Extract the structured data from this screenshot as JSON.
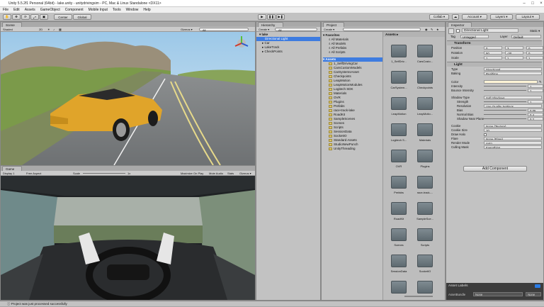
{
  "titlebar": {
    "text": "Unity 5.5.2f1 Personal (64bit) - lake.unity - unitydrivingsim - PC, Mac & Linux Standalone <DX11>"
  },
  "menu": [
    "File",
    "Edit",
    "Assets",
    "GameObject",
    "Component",
    "Mobile Input",
    "Tools",
    "Window",
    "Help"
  ],
  "toolbar": {
    "center": "Center",
    "global": "Global",
    "collab": "Collab ▾",
    "account": "Account ▾",
    "layers": "Layers ▾",
    "layout": "Layout ▾"
  },
  "scene": {
    "tab": "Scene",
    "shaded": "Shaded",
    "mode2d": "2D",
    "gizmos": "Gizmos ▾",
    "search": "All"
  },
  "game": {
    "tab": "Game",
    "display": "Display 1",
    "aspect": "Free Aspect",
    "scale_label": "Scale",
    "scale_value": "1x",
    "maximize": "Maximize On Play",
    "mute": "Mute Audio",
    "stats": "Stats",
    "gizmos": "Gizmos ▾"
  },
  "hierarchy": {
    "tab": "Hierarchy",
    "create": "Create ▾",
    "search": "All",
    "scene_name": "lake",
    "items": [
      "Directional Light",
      "Car",
      "LakeTrack",
      "CheckPoints"
    ]
  },
  "project": {
    "tab": "Project",
    "create": "Create ▾",
    "favorites_label": "Favorites",
    "favorites": [
      "All Materials",
      "All Models",
      "All Prefabs",
      "All Scripts"
    ],
    "assets_label": "Assets",
    "folders": [
      "1_SelfDrivingCar",
      "CarsCustomModels",
      "CarSystemsAsset",
      "Checkpoints",
      "LeapMotion",
      "LeapMotionModules",
      "Logitech SDK",
      "Materials",
      "OVR",
      "Plugins",
      "Prefabs",
      "race-track-lake",
      "RoadKit",
      "SampleScenes",
      "Scenes",
      "Scripts",
      "SessionData",
      "SocketIO",
      "Standard Assets",
      "StudioNewPunch",
      "UnityThreading"
    ],
    "grid_header": "Assets ▸",
    "grid": [
      "1_SelfDriv...",
      "CarsCusto...",
      "CarSystem...",
      "Checkpoints",
      "LeapMotion",
      "LeapMotio...",
      "Logitech S...",
      "Materials",
      "OVR",
      "Plugins",
      "Prefabs",
      "race-track-...",
      "RoadKit",
      "SampleSce...",
      "Scenes",
      "Scripts",
      "SessionData",
      "SocketIO",
      "",
      ""
    ]
  },
  "inspector": {
    "tab": "Inspector",
    "object_name": "Directional Light",
    "static": "Static ▾",
    "tag_label": "Tag",
    "tag_value": "Untagged",
    "layer_label": "Layer",
    "layer_value": "Default",
    "transform": {
      "header": "Transform",
      "position": [
        "0",
        "3",
        "0"
      ],
      "rotation": [
        "50",
        "-30",
        "0"
      ],
      "scale": [
        "1",
        "1",
        "1"
      ],
      "pos_label": "Position",
      "rot_label": "Rotation",
      "scale_label": "Scale"
    },
    "light_header": "Light",
    "light_rows": [
      {
        "k": "Type",
        "v": "Directional"
      },
      {
        "k": "Baking",
        "v": "Realtime"
      },
      {
        "k": "Color",
        "v": ""
      },
      {
        "k": "Intensity",
        "v": "1"
      },
      {
        "k": "Bounce Intensity",
        "v": "1"
      },
      {
        "k": "Shadow Type",
        "v": "Soft Shadows"
      },
      {
        "k": "Strength",
        "v": "1"
      },
      {
        "k": "Resolution",
        "v": "Use Quality Settings"
      },
      {
        "k": "Bias",
        "v": "0.05"
      },
      {
        "k": "Normal Bias",
        "v": "0.4"
      },
      {
        "k": "Shadow Near Plane",
        "v": "0.2"
      },
      {
        "k": "Cookie",
        "v": "None (Texture)"
      },
      {
        "k": "Cookie Size",
        "v": "10"
      },
      {
        "k": "Draw Halo",
        "v": ""
      },
      {
        "k": "Flare",
        "v": "None (Flare)"
      },
      {
        "k": "Render Mode",
        "v": "Auto"
      },
      {
        "k": "Culling Mask",
        "v": "Everything"
      }
    ],
    "add_component": "Add Component",
    "asset_labels": "Asset Labels",
    "asset_bundle_label": "AssetBundle",
    "asset_bundle_value": "None",
    "asset_bundle_value2": "None"
  },
  "play": {
    "play": "▶",
    "pause": "❚❚",
    "step": "▶❚"
  },
  "status": {
    "text": "Project was just processed successfully"
  },
  "colors": {
    "selection": "#3e7ce0",
    "panel": "#c2c2c2",
    "car": "#e0a42a"
  }
}
